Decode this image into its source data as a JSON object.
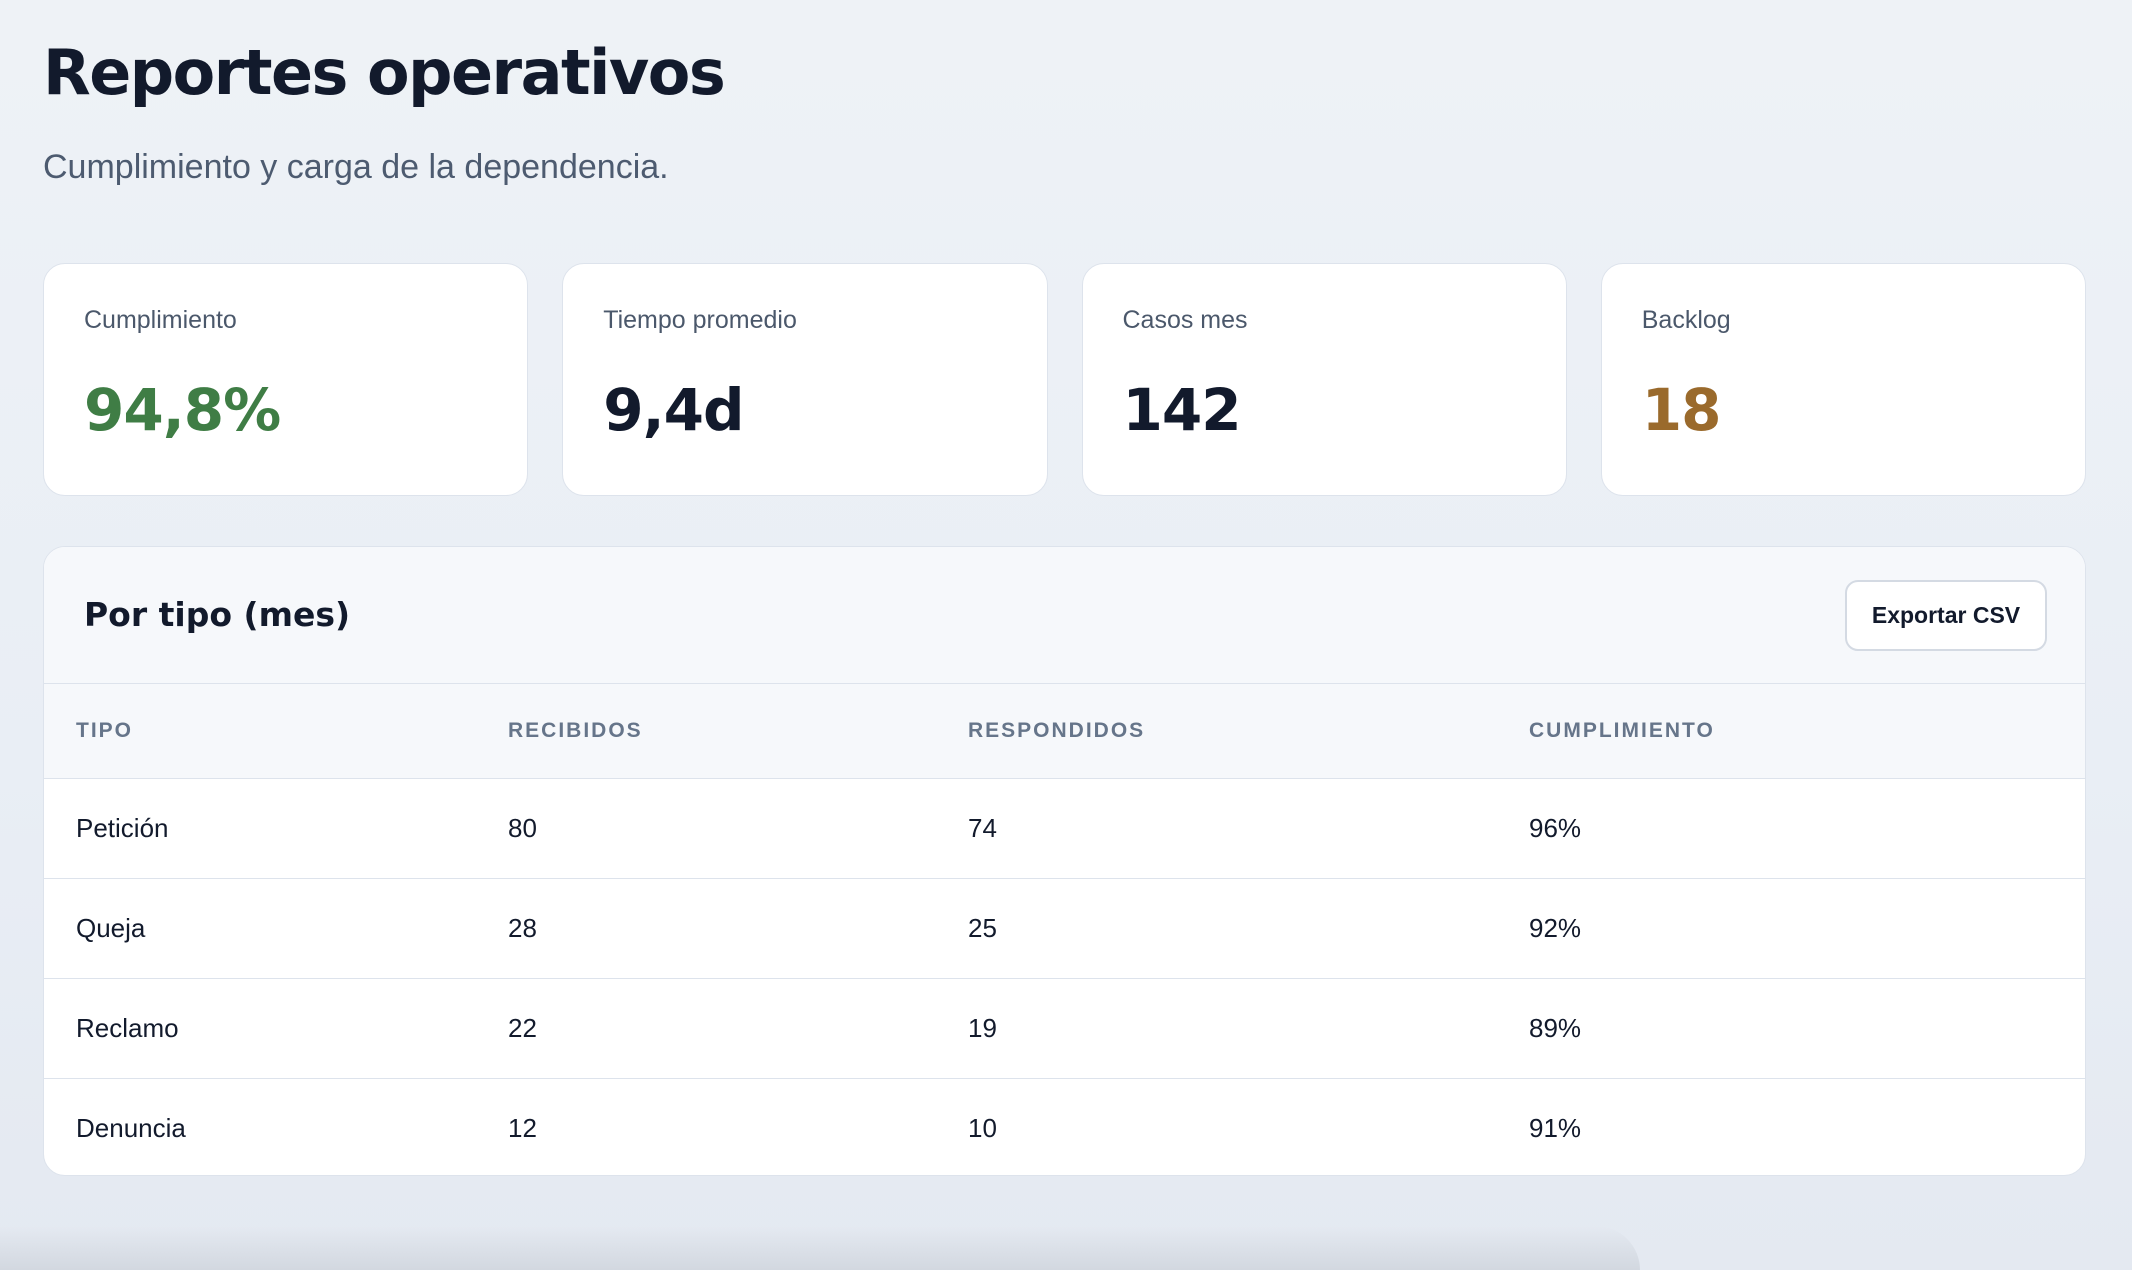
{
  "header": {
    "title": "Reportes operativos",
    "subtitle": "Cumplimiento y carga de la dependencia."
  },
  "kpis": [
    {
      "label": "Cumplimiento",
      "value": "94,8%",
      "color": "#3f7d45"
    },
    {
      "label": "Tiempo promedio",
      "value": "9,4d",
      "color": "#121a2c"
    },
    {
      "label": "Casos mes",
      "value": "142",
      "color": "#121a2c"
    },
    {
      "label": "Backlog",
      "value": "18",
      "color": "#9a6a2c"
    }
  ],
  "report": {
    "title": "Por tipo (mes)",
    "export_label": "Exportar CSV",
    "columns": [
      "TIPO",
      "RECIBIDOS",
      "RESPONDIDOS",
      "CUMPLIMIENTO"
    ],
    "rows": [
      [
        "Petición",
        "80",
        "74",
        "96%"
      ],
      [
        "Queja",
        "28",
        "25",
        "92%"
      ],
      [
        "Reclamo",
        "22",
        "19",
        "89%"
      ],
      [
        "Denuncia",
        "12",
        "10",
        "91%"
      ]
    ]
  }
}
